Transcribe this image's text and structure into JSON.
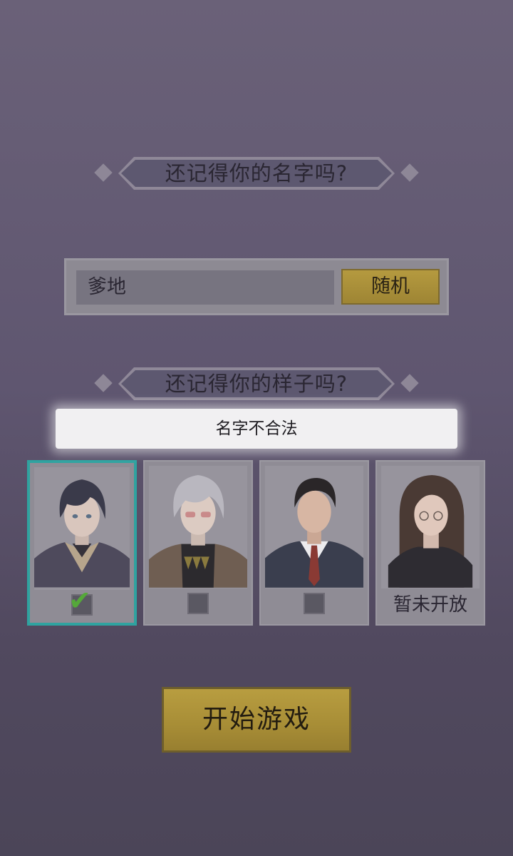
{
  "name_section": {
    "prompt": "还记得你的名字吗?",
    "name_value": "爹地",
    "random_label": "随机"
  },
  "appearance_section": {
    "prompt": "还记得你的样子吗?"
  },
  "toast": {
    "message": "名字不合法"
  },
  "characters": [
    {
      "selected": true,
      "hair_color": "#3a3a4a"
    },
    {
      "selected": false,
      "hair_color": "#b9b7bf"
    },
    {
      "selected": false,
      "hair_color": "#2a2628"
    },
    {
      "selected": false,
      "locked_label": "暂未开放",
      "hair_color": "#4a3a34"
    }
  ],
  "start_button": {
    "label": "开始游戏"
  },
  "colors": {
    "gold": "#b59a3f",
    "selected_border": "#2fa3a0",
    "check_green": "#55a83a"
  }
}
